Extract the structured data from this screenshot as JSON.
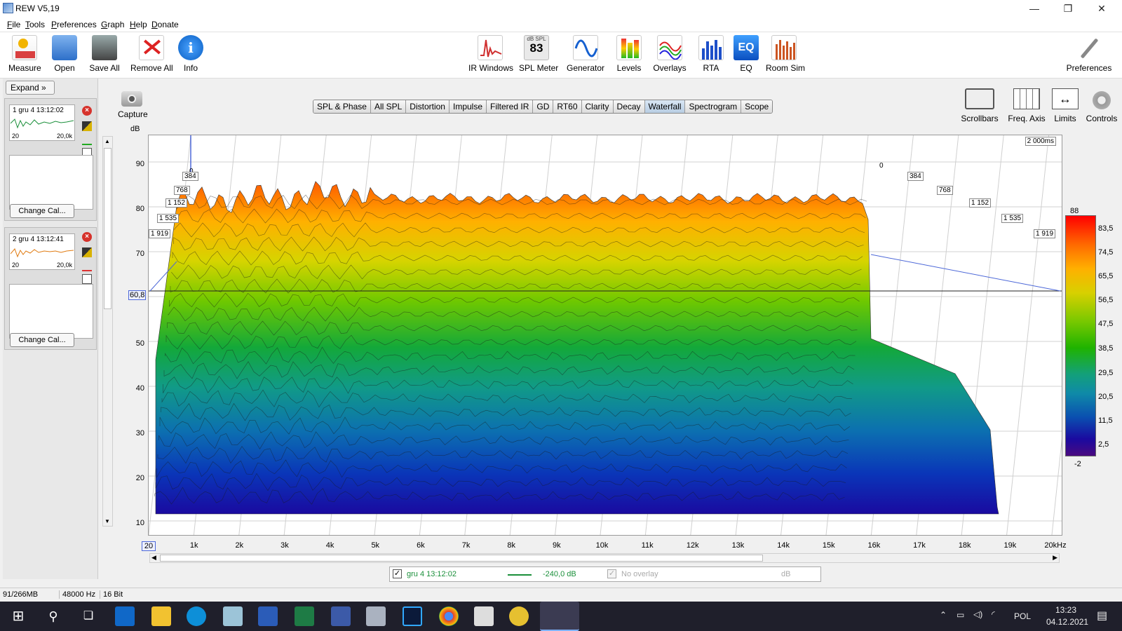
{
  "window": {
    "title": "REW V5,19",
    "minimize": "—",
    "restore": "❐",
    "close": "✕"
  },
  "menu": [
    "File",
    "Tools",
    "Preferences",
    "Graph",
    "Help",
    "Donate"
  ],
  "toolbar_left": [
    "Measure",
    "Open",
    "Save All",
    "Remove All",
    "Info"
  ],
  "toolbar_center": [
    "IR Windows",
    "SPL Meter",
    "Generator",
    "Levels",
    "Overlays",
    "RTA",
    "EQ",
    "Room Sim"
  ],
  "spl_meter": {
    "unit": "dB SPL",
    "value": "83"
  },
  "toolbar_right": "Preferences",
  "left_panel": {
    "expand_label": "Expand",
    "measurements": [
      {
        "name": "1  gru 4 13:12:02",
        "range_start": "20",
        "range_end": "20,0k",
        "cal_label": "Change Cal..."
      },
      {
        "name": "2  gru 4 13:12:41",
        "range_start": "20",
        "range_end": "20,0k",
        "cal_label": "Change Cal..."
      }
    ]
  },
  "capture_label": "Capture",
  "graph_tabs": [
    "SPL & Phase",
    "All SPL",
    "Distortion",
    "Impulse",
    "Filtered IR",
    "GD",
    "RT60",
    "Clarity",
    "Decay",
    "Waterfall",
    "Spectrogram",
    "Scope"
  ],
  "active_tab": "Waterfall",
  "right_tools": [
    "Scrollbars",
    "Freq. Axis",
    "Limits",
    "Controls"
  ],
  "plot": {
    "y_unit": "dB",
    "y_ticks": [
      "90",
      "80",
      "70",
      "60,8",
      "50",
      "40",
      "30",
      "20",
      "10"
    ],
    "x_ticks": [
      "20",
      "1k",
      "2k",
      "3k",
      "4k",
      "5k",
      "6k",
      "7k",
      "8k",
      "9k",
      "10k",
      "11k",
      "12k",
      "13k",
      "14k",
      "15k",
      "16k",
      "17k",
      "18k",
      "19k",
      "20kHz"
    ],
    "time_label": "2 000ms",
    "front_times": [
      "0",
      "384",
      "768",
      "1 152",
      "1 535",
      "1 919"
    ],
    "back_times": [
      "0",
      "384",
      "768",
      "1 152",
      "1 535",
      "1 919"
    ],
    "cursor_db": "60,8",
    "colorbar": [
      "88",
      "83,5",
      "74,5",
      "65,5",
      "56,5",
      "47,5",
      "38,5",
      "29,5",
      "20,5",
      "11,5",
      "2,5",
      "-2"
    ]
  },
  "legend": {
    "name": "gru 4 13:12:02",
    "value": "-240,0 dB",
    "overlay": "No overlay",
    "overlay_unit": "dB",
    "line_color": "#1a8f3a"
  },
  "status": {
    "memory": "91/266MB",
    "rate": "48000 Hz",
    "bits": "16 Bit"
  },
  "taskbar": {
    "time": "13:23",
    "date": "04.12.2021",
    "lang": "POL"
  }
}
